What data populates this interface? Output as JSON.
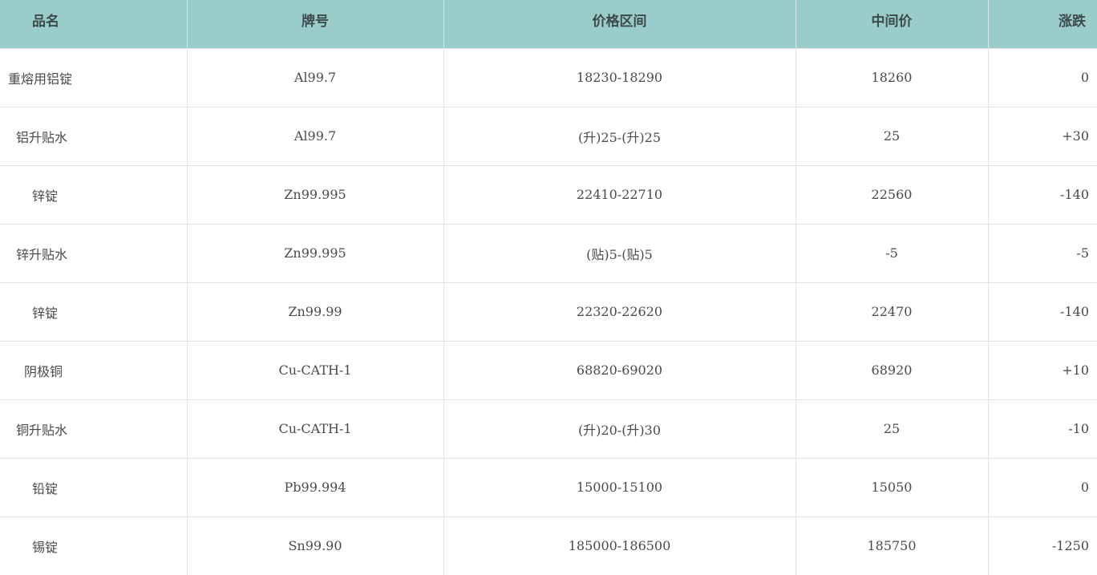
{
  "table": {
    "headers": {
      "name": "品名",
      "grade": "牌号",
      "price_range": "价格区间",
      "mid_price": "中间价",
      "change": "涨跌"
    },
    "rows": [
      {
        "name": "重熔用铝锭",
        "grade": "Al99.7",
        "price_range": "18230-18290",
        "mid_price": "18260",
        "change": "0"
      },
      {
        "name": "铝升贴水",
        "grade": "Al99.7",
        "price_range": "(升)25-(升)25",
        "mid_price": "25",
        "change": "+30"
      },
      {
        "name": "锌锭",
        "grade": "Zn99.995",
        "price_range": "22410-22710",
        "mid_price": "22560",
        "change": "-140"
      },
      {
        "name": "锌升贴水",
        "grade": "Zn99.995",
        "price_range": "(贴)5-(贴)5",
        "mid_price": "-5",
        "change": "-5"
      },
      {
        "name": "锌锭",
        "grade": "Zn99.99",
        "price_range": "22320-22620",
        "mid_price": "22470",
        "change": "-140"
      },
      {
        "name": "阴极铜",
        "grade": "Cu-CATH-1",
        "price_range": "68820-69020",
        "mid_price": "68920",
        "change": "+10"
      },
      {
        "name": "铜升贴水",
        "grade": "Cu-CATH-1",
        "price_range": "(升)20-(升)30",
        "mid_price": "25",
        "change": "-10"
      },
      {
        "name": "铅锭",
        "grade": "Pb99.994",
        "price_range": "15000-15100",
        "mid_price": "15050",
        "change": "0"
      },
      {
        "name": "锡锭",
        "grade": "Sn99.90",
        "price_range": "185000-186500",
        "mid_price": "185750",
        "change": "-1250"
      }
    ]
  },
  "colors": {
    "header_background": "#9bcccc",
    "header_text": "#3d4a4a",
    "cell_text": "#4a4a4a",
    "grid_line": "#e4e4e4"
  }
}
